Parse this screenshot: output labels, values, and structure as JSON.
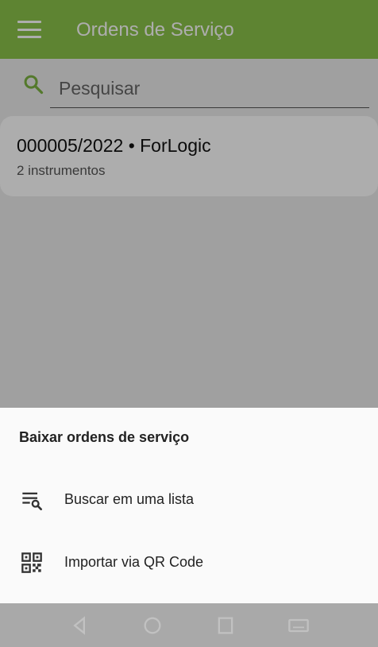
{
  "appbar": {
    "title": "Ordens de Serviço",
    "menu_icon": "menu-icon",
    "color": "#8bc34a"
  },
  "search": {
    "placeholder": "Pesquisar",
    "value": "",
    "icon": "search-icon"
  },
  "orders": [
    {
      "title": "000005/2022 • ForLogic",
      "subtitle": "2 instrumentos"
    }
  ],
  "sheet": {
    "title": "Baixar ordens de serviço",
    "items": [
      {
        "label": "Buscar em uma lista",
        "icon": "list-search-icon"
      },
      {
        "label": "Importar via QR Code",
        "icon": "qr-code-icon"
      }
    ]
  },
  "navbar": {
    "buttons": [
      "back-icon",
      "home-icon",
      "recents-icon",
      "keyboard-icon"
    ]
  }
}
